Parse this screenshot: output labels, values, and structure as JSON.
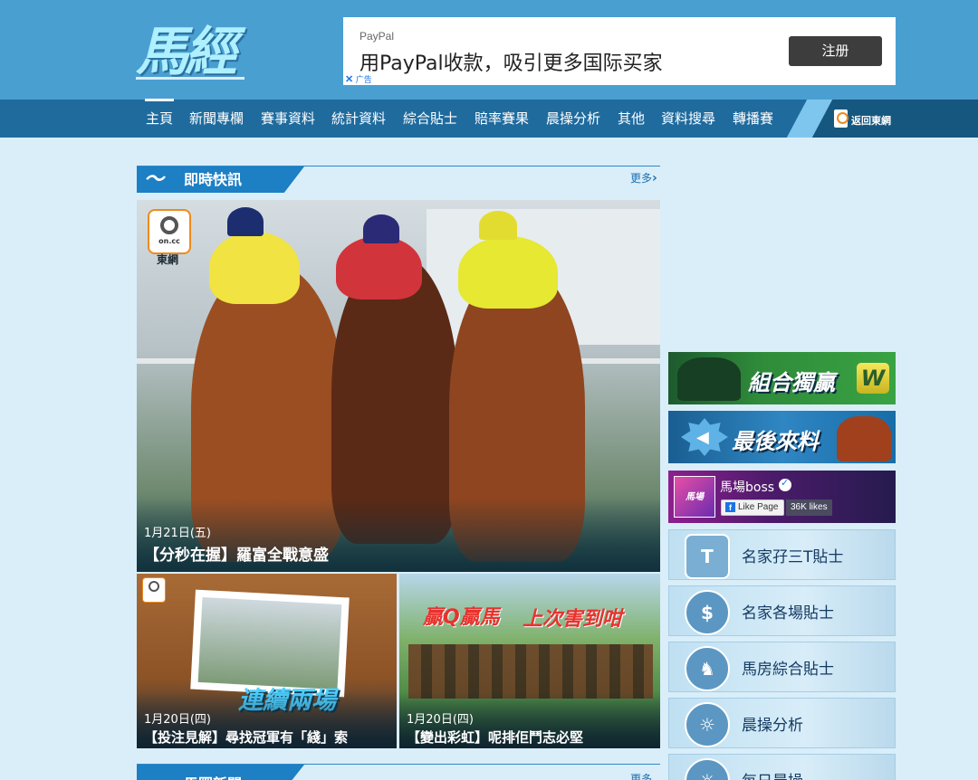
{
  "site": {
    "logo_text": "馬經"
  },
  "ad": {
    "brand": "PayPal",
    "headline": "用PayPal收款，吸引更多国际买家",
    "cta": "注册",
    "label": "广告"
  },
  "nav": {
    "items": [
      "主頁",
      "新聞專欄",
      "賽事資料",
      "統計資料",
      "綜合貼士",
      "賠率賽果",
      "晨操分析",
      "其他",
      "資料搜尋",
      "轉播賽"
    ],
    "return_label": "返回東網",
    "return_icon_caption": "東網"
  },
  "flash": {
    "title": "即時快訊",
    "more": "更多",
    "hero": {
      "source": "東網",
      "date": "1月21日(五)",
      "title": "【分秒在握】羅富全戰意盛"
    },
    "cards": [
      {
        "date": "1月20日(四)",
        "title": "【投注見解】尋找冠軍有「綫」索",
        "overlay": "連續兩場"
      },
      {
        "date": "1月20日(四)",
        "title": "【變出彩虹】呢排佢鬥志必堅",
        "overlay_left": "贏Q贏馬",
        "overlay_right": "上次害到咁"
      }
    ]
  },
  "news": {
    "title": "馬圈新聞",
    "more": "更多"
  },
  "sidebar": {
    "banners": [
      {
        "label": "組合獨贏",
        "badge": "W"
      },
      {
        "label": "最後來料"
      }
    ],
    "facebook": {
      "avatar_text": "馬場BOSS",
      "page_name": "馬場boss",
      "like_label": "Like Page",
      "likes": "36K likes"
    },
    "tips": [
      {
        "label": "名家孖三T貼士",
        "icon": "T"
      },
      {
        "label": "名家各場貼士",
        "icon": "$"
      },
      {
        "label": "馬房綜合貼士",
        "icon": "♞"
      },
      {
        "label": "晨操分析",
        "icon": "☼"
      },
      {
        "label": "每日晨操",
        "icon": "☼"
      }
    ]
  },
  "colors": {
    "header_bg": "#4a9fd1",
    "nav_bg": "#1f6b9e",
    "page_bg": "#d9eef9",
    "section_tab": "#1d7fc4"
  }
}
